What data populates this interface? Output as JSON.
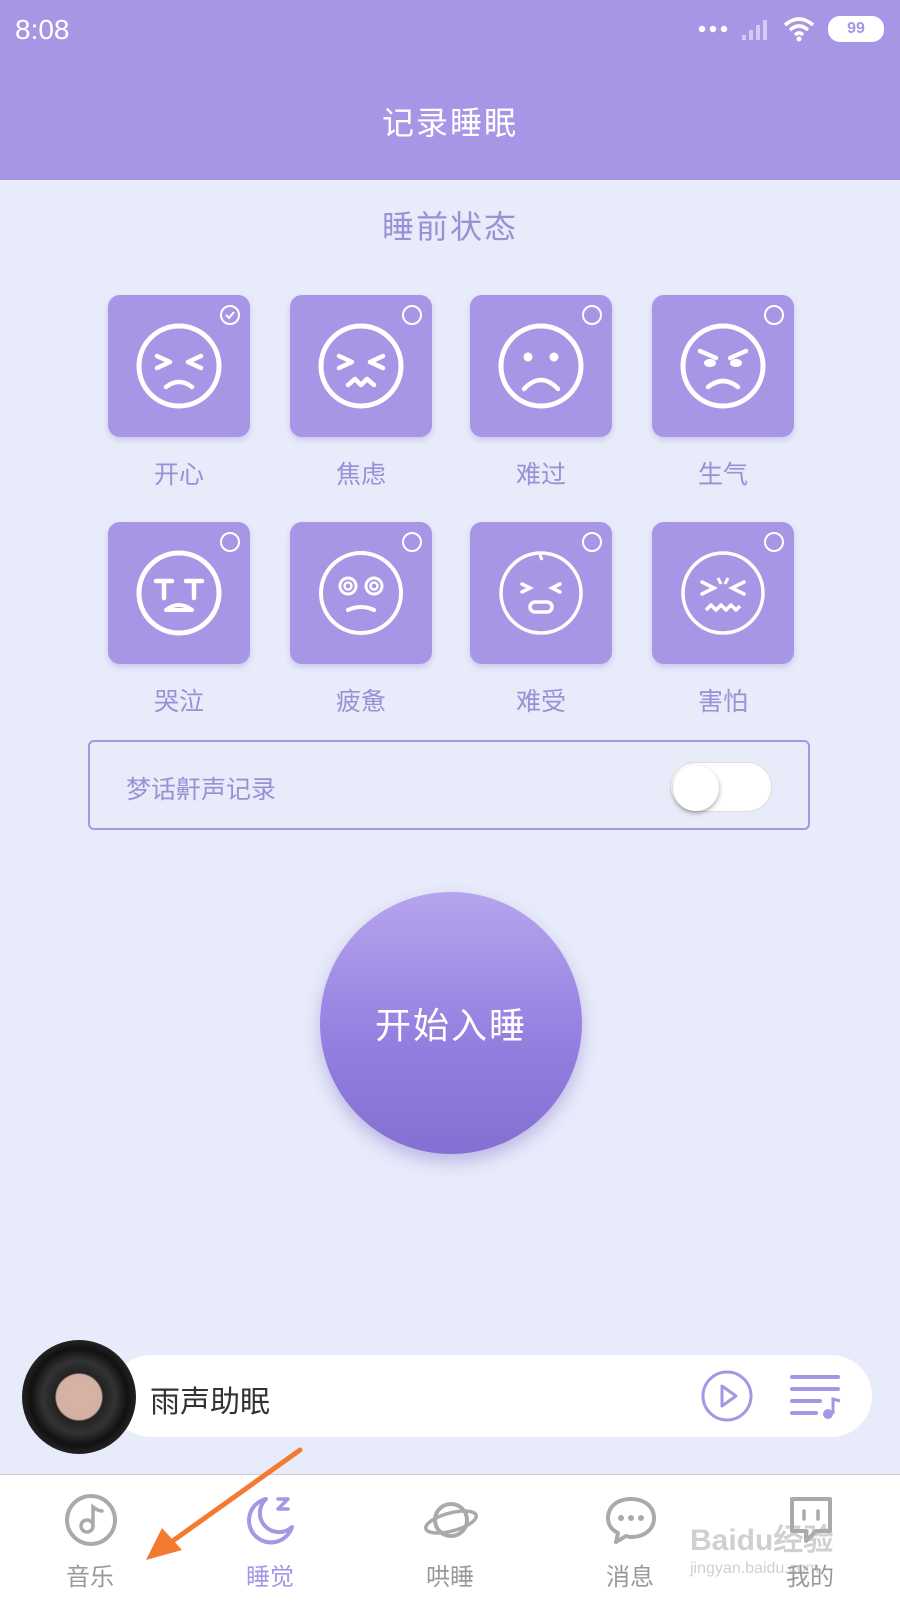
{
  "status_bar": {
    "time": "8:08",
    "battery": "99"
  },
  "header": {
    "title": "记录睡眠"
  },
  "section_title": "睡前状态",
  "moods": [
    {
      "label": "开心",
      "checked": true,
      "icon": "squint-face-icon"
    },
    {
      "label": "焦虑",
      "checked": false,
      "icon": "anxious-face-icon"
    },
    {
      "label": "难过",
      "checked": false,
      "icon": "sad-face-icon"
    },
    {
      "label": "生气",
      "checked": false,
      "icon": "angry-face-icon"
    },
    {
      "label": "哭泣",
      "checked": false,
      "icon": "crying-face-icon"
    },
    {
      "label": "疲惫",
      "checked": false,
      "icon": "dizzy-face-icon"
    },
    {
      "label": "难受",
      "checked": false,
      "icon": "uncomfortable-face-icon"
    },
    {
      "label": "害怕",
      "checked": false,
      "icon": "scared-face-icon"
    }
  ],
  "sleep_talk_toggle": {
    "label": "梦话鼾声记录",
    "on": false
  },
  "start_button": {
    "label": "开始入睡"
  },
  "player": {
    "title": "雨声助眠"
  },
  "tabs": [
    {
      "label": "音乐",
      "icon": "music-icon",
      "active": false
    },
    {
      "label": "睡觉",
      "icon": "moon-sleep-icon",
      "active": true
    },
    {
      "label": "哄睡",
      "icon": "planet-icon",
      "active": false
    },
    {
      "label": "消息",
      "icon": "chat-bubble-icon",
      "active": false
    },
    {
      "label": "我的",
      "icon": "profile-icon",
      "active": false
    }
  ],
  "watermark": {
    "text": "Baidu经验",
    "sub": "jingyan.baidu.com"
  },
  "colors": {
    "accent": "#a796e5",
    "background": "#e8ebfa",
    "arrow": "#f47a32"
  }
}
